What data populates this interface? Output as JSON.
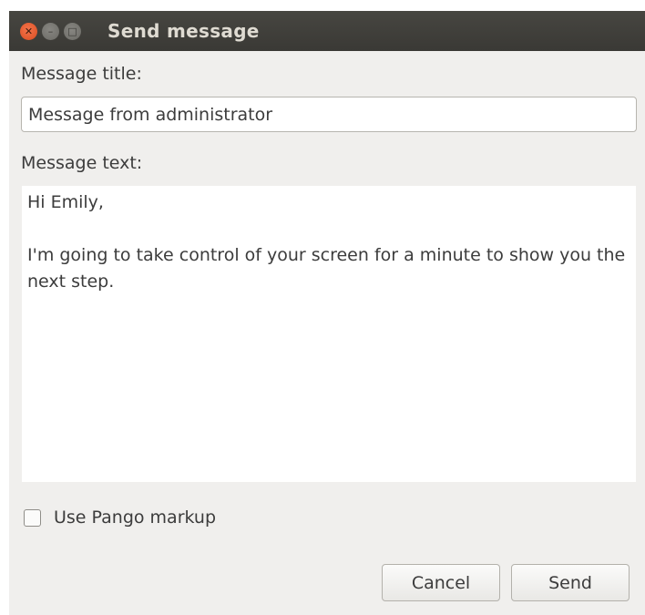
{
  "window": {
    "title": "Send message",
    "controls": {
      "close_icon": "close-icon",
      "minimize_icon": "minimize-icon",
      "maximize_icon": "maximize-icon"
    }
  },
  "form": {
    "title_label": "Message title:",
    "title_value": "Message from administrator",
    "text_label": "Message text:",
    "text_value": "Hi Emily,\n\nI'm going to take control of your screen for a minute to show you the next step.",
    "checkbox_label": "Use Pango markup",
    "checkbox_checked": false
  },
  "buttons": {
    "cancel_label": "Cancel",
    "send_label": "Send"
  },
  "colors": {
    "titlebar": "#3c3b37",
    "close_button": "#e8562a",
    "window_background": "#f0efed"
  }
}
